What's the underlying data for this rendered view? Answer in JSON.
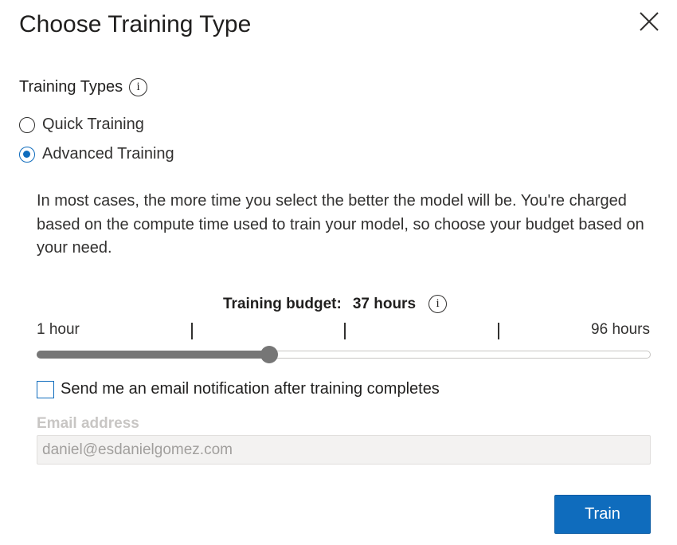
{
  "dialog": {
    "title": "Choose Training Type",
    "close_icon": "close-icon"
  },
  "training_types": {
    "label": "Training Types",
    "info_glyph": "i",
    "options": [
      {
        "label": "Quick Training",
        "selected": false
      },
      {
        "label": "Advanced Training",
        "selected": true
      }
    ]
  },
  "description": "In most cases, the more time you select the better the model will be. You're charged based on the compute time used to train your model, so choose your budget based on your need.",
  "budget": {
    "label": "Training budget:",
    "value_text": "37 hours",
    "info_glyph": "i",
    "min_label": "1 hour",
    "max_label": "96 hours",
    "min": 1,
    "max": 96,
    "value": 37,
    "tick_count": 3
  },
  "notification": {
    "checkbox_label": "Send me an email notification after training completes",
    "checked": false,
    "email_label": "Email address",
    "email_placeholder": "daniel@esdanielgomez.com"
  },
  "actions": {
    "train_label": "Train"
  },
  "colors": {
    "accent": "#0f6cbd",
    "slider": "#767676",
    "disabled_text": "#c8c6c4"
  }
}
